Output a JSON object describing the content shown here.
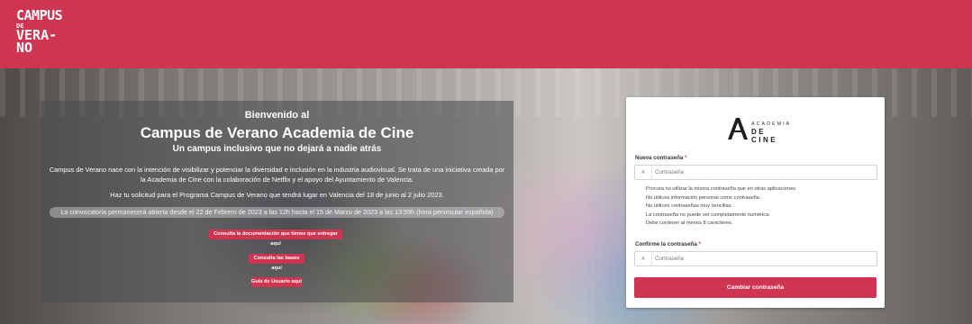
{
  "header": {
    "logo_line1": "CAMPUS",
    "logo_line2": "DE",
    "logo_line3": "VERA-",
    "logo_line4": "NO",
    "background_color": "#cf3450"
  },
  "welcome": {
    "greeting": "Bienvenido al",
    "title": "Campus de Verano Academia de Cine",
    "subtitle": "Un campus inclusivo que no dejará a nadie atrás",
    "description": "Campus de Verano nace con la intención de visibilizar y potenciar la diversidad e inclusión en la industria audiovisual. Se trata de una iniciativa creada por la Academia de Cine con la colaboración de Netflix y el apoyo del Ayuntamiento de Valencia.",
    "request_info": "Haz tu solicitud para el Programa Campus de Verano que tendrá lugar en Valencia del 18 de junio al 2 julio 2023.",
    "notice": "La convocatoria permanecerá abierta desde el 22 de Febrero de 2023 a las 12h hasta el 15 de Marzo de 2023 a las 13:59h (hora peninsular española)",
    "buttons": {
      "docs": "Consulta la documentación que tienes que entregar aquí",
      "bases": "Consulta las bases aquí",
      "guide": "Guía de Usuario aquí"
    }
  },
  "card": {
    "logo_text_top": "ACADEMIA",
    "logo_text_bottom": "DE CINE",
    "new_password_label": "Nueva contraseña",
    "confirm_password_label": "Confirme la contraseña",
    "required_mark": "*",
    "input_prefix": "#",
    "new_password_placeholder": "Contraseña",
    "confirm_password_placeholder": "Contraseña",
    "hints": [
      "Procura no utilizar la misma contraseña que en otras aplicaciones.",
      "No utilices información personal como contraseña.",
      "No utilices contraseñas muy sencillas.",
      "La contraseña no puede ser completamente numérica.",
      "Debe contener al menos 8 carácteres."
    ],
    "submit_label": "Cambiar contraseña"
  }
}
